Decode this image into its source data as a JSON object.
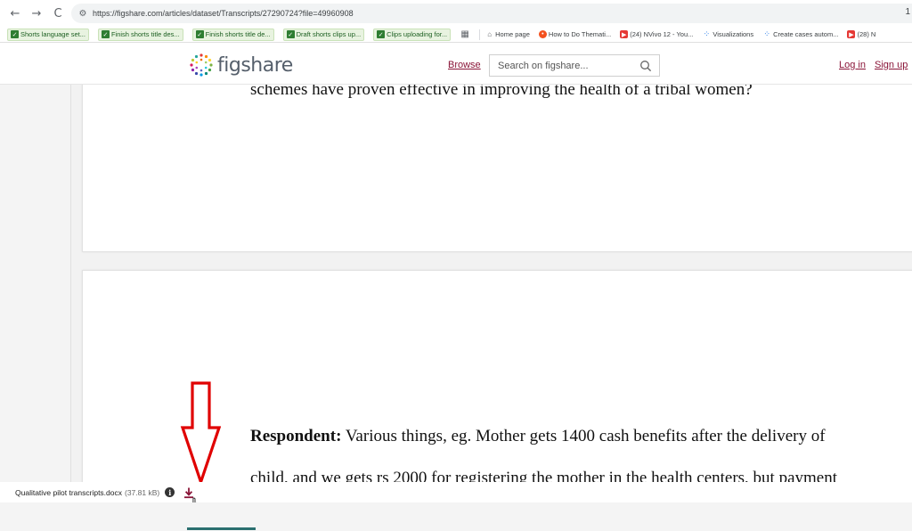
{
  "browser": {
    "nav": {
      "back": "←",
      "forward": "→",
      "reload": "C"
    },
    "url": "https://figshare.com/articles/dataset/Transcripts/27290724?file=49960908",
    "right_glyph": "1"
  },
  "bookmarks": [
    {
      "label": "Shorts language set...",
      "icon": "checkbox-icon",
      "style": "green"
    },
    {
      "label": "Finish shorts title des...",
      "icon": "checkbox-icon",
      "style": "green"
    },
    {
      "label": "Finish shorts title de...",
      "icon": "checkbox-icon",
      "style": "green"
    },
    {
      "label": "Draft shorts clips up...",
      "icon": "checkbox-icon",
      "style": "green"
    },
    {
      "label": "Clips uploading for...",
      "icon": "checkbox-icon",
      "style": "green"
    },
    {
      "label": "Home page",
      "icon": "home-icon",
      "style": "plain"
    },
    {
      "label": "How to Do Themati...",
      "icon": "site-icon",
      "style": "plain"
    },
    {
      "label": "(24) NVivo 12 - You...",
      "icon": "youtube-icon",
      "style": "plain"
    },
    {
      "label": "Visualizations",
      "icon": "visualizations-icon",
      "style": "plain"
    },
    {
      "label": "Create cases autom...",
      "icon": "visualizations-icon",
      "style": "plain"
    },
    {
      "label": "(28) N",
      "icon": "youtube-icon",
      "style": "plain"
    }
  ],
  "header": {
    "logo_text": "figshare",
    "browse": "Browse",
    "search_placeholder": "Search on figshare...",
    "login": "Log in",
    "signup": "Sign up"
  },
  "document": {
    "page1_text": "schemes have proven effective in improving the health of a tribal women?",
    "respondent_label": "Respondent:",
    "respondent_text": " Various things, eg. Mother gets 1400 cash benefits after the delivery of",
    "line2_text": "child, and we gets rs 2000 for registering the mother in the health centers, but payment"
  },
  "file": {
    "name": "Qualitative pilot transcripts.docx",
    "size": "(37.81 kB)"
  },
  "colors": {
    "accent": "#8a1538",
    "annotation": "#e00000",
    "tab_indicator": "#2a6f6f"
  }
}
